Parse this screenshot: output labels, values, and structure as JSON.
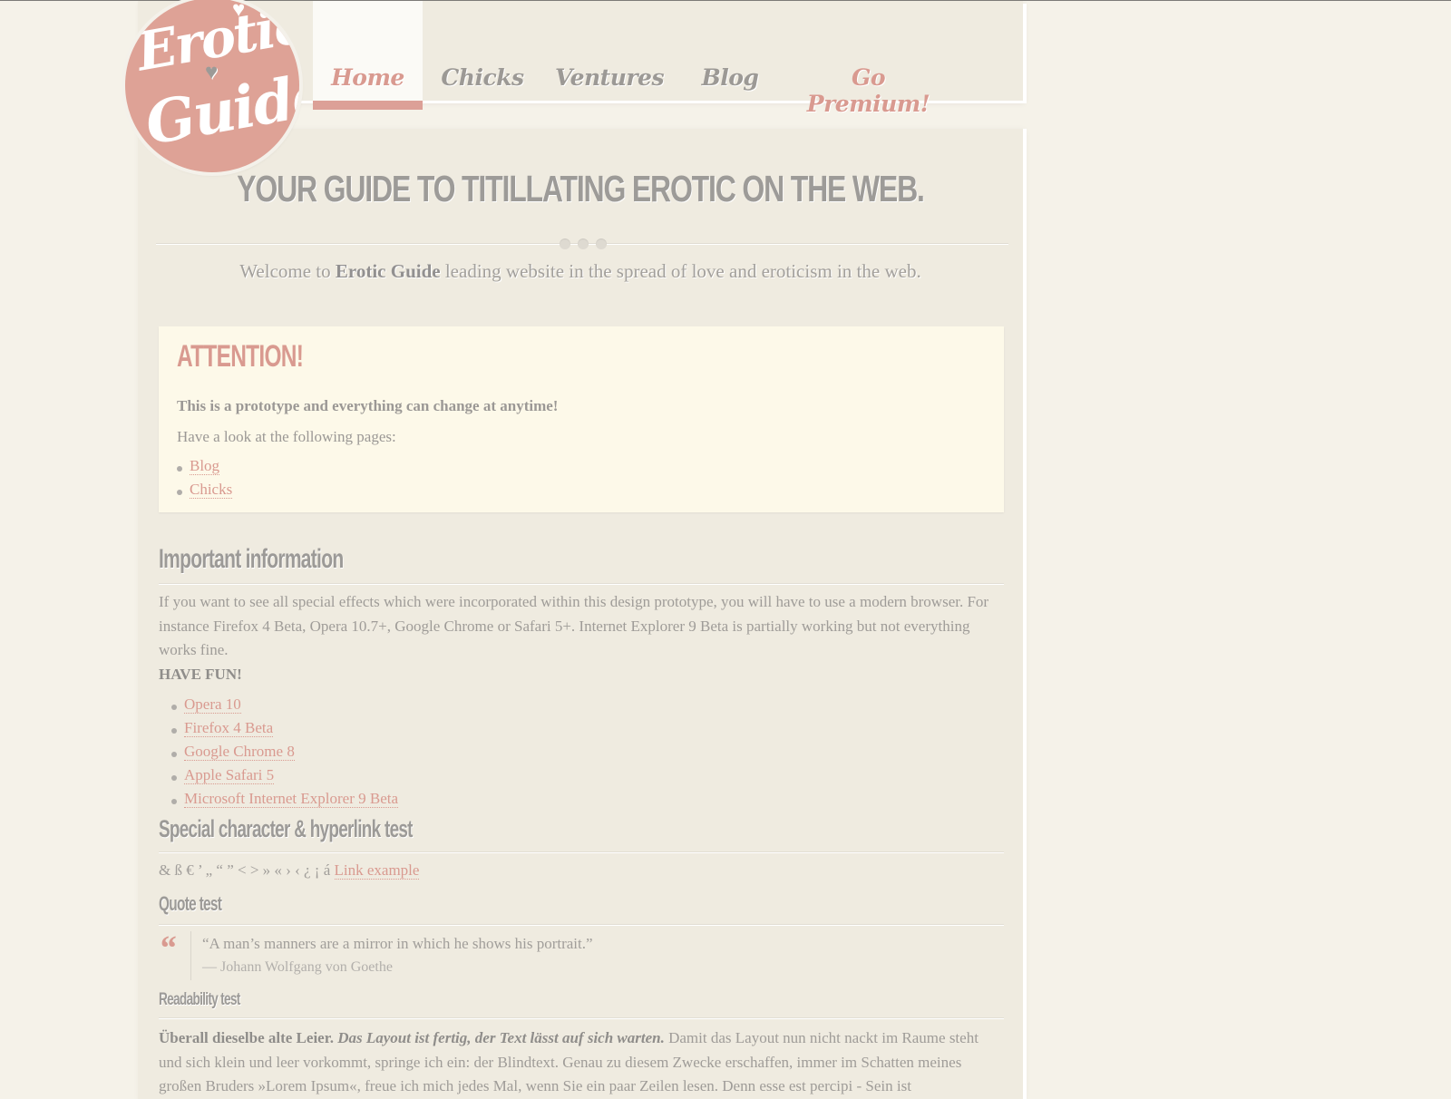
{
  "logo": {
    "line1": "Erotic",
    "line2": "Guide"
  },
  "nav": {
    "items": [
      {
        "label": "Home",
        "active": true
      },
      {
        "label": "Chicks"
      },
      {
        "label": "Ventures"
      },
      {
        "label": "Blog"
      },
      {
        "label": "Go Premium!",
        "highlight": true
      }
    ]
  },
  "header": {
    "tagline": "YOUR GUIDE TO TITILLATING EROTIC ON THE WEB.",
    "welcome_prefix": "Welcome to ",
    "welcome_brand": "Erotic Guide",
    "welcome_suffix": " leading website in the spread of love and eroticism in the web."
  },
  "attention": {
    "title": "ATTENTION!",
    "bold_text": "This is a prototype and everything can change at anytime!",
    "text": "Have a look at the following pages:",
    "links": [
      "Blog",
      "Chicks"
    ]
  },
  "important": {
    "title": "Important information",
    "paragraph": "If you want to see all special effects which were incorporated within this design prototype, you will have to use a modern browser. For instance Firefox 4 Beta, Opera 10.7+, Google Chrome or Safari 5+. Internet Explorer 9 Beta is partially working but not everything works fine.",
    "have_fun": "HAVE FUN!",
    "browsers": [
      "Opera 10",
      "Firefox 4 Beta",
      "Google Chrome 8",
      "Apple Safari 5",
      "Microsoft Internet Explorer 9 Beta"
    ]
  },
  "special": {
    "title": "Special character & hyperlink test",
    "chars": "& ß € ’ „ “ ” < > » « › ‹ ¿ ¡ á ",
    "link": "Link example"
  },
  "quote": {
    "title": "Quote test",
    "mark": "“",
    "text": "“A man’s manners are a mirror in which he shows his portrait.”",
    "author": "— Johann Wolfgang von Goethe"
  },
  "readability": {
    "title": "Readability test",
    "bold": "Überall dieselbe alte Leier.",
    "bold_italic": "Das Layout ist fertig, der Text lässt auf sich warten.",
    "text": " Damit das Layout nun nicht nackt im Raume steht und sich klein und leer vorkommt, springe ich ein: der Blindtext. Genau zu diesem Zwecke erschaffen, immer im Schatten meines großen Bruders »Lorem Ipsum«, freue ich mich jedes Mal, wenn Sie ein paar Zeilen lesen. Denn esse est percipi - Sein ist"
  }
}
